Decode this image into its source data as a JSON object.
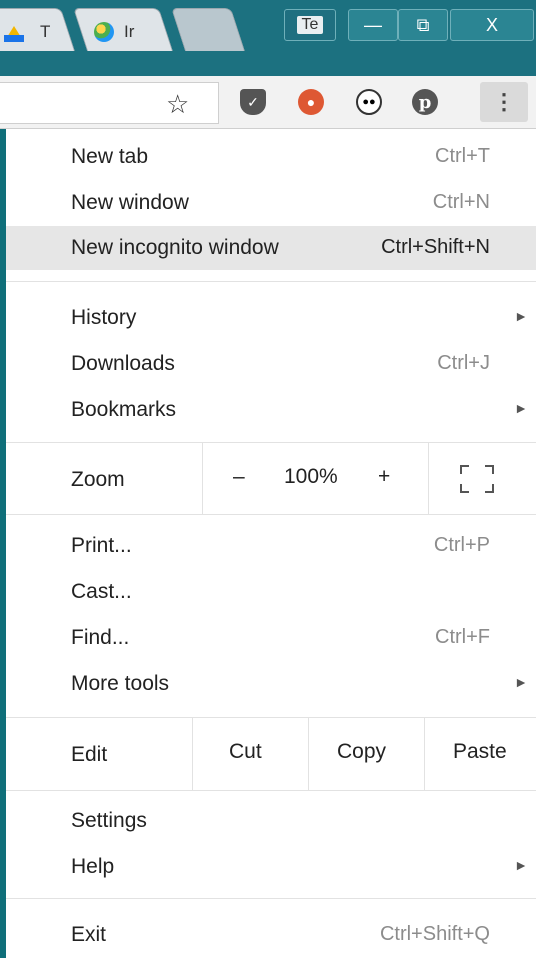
{
  "titlebar": {
    "tabs": [
      {
        "label": "T",
        "icon": "google-drive-icon"
      },
      {
        "label": "Ir",
        "icon": "browser-tab-icon"
      }
    ],
    "profile_label": "Te",
    "minimize_glyph": "—",
    "maximize_glyph": "⧉",
    "close_glyph": "X"
  },
  "toolbar": {
    "bookmark_star_glyph": "☆",
    "extensions": [
      "pocket-icon",
      "duckduckgo-icon",
      "panda-icon",
      "pinterest-icon"
    ],
    "pinterest_glyph": "p",
    "menu_glyph": "⋮"
  },
  "menu": {
    "new_tab": {
      "label": "New tab",
      "shortcut": "Ctrl+T"
    },
    "new_window": {
      "label": "New window",
      "shortcut": "Ctrl+N"
    },
    "new_incognito": {
      "label": "New incognito window",
      "shortcut": "Ctrl+Shift+N"
    },
    "history": {
      "label": "History"
    },
    "downloads": {
      "label": "Downloads",
      "shortcut": "Ctrl+J"
    },
    "bookmarks": {
      "label": "Bookmarks"
    },
    "zoom": {
      "label": "Zoom",
      "minus": "–",
      "value": "100%",
      "plus": "+"
    },
    "print": {
      "label": "Print...",
      "shortcut": "Ctrl+P"
    },
    "cast": {
      "label": "Cast..."
    },
    "find": {
      "label": "Find...",
      "shortcut": "Ctrl+F"
    },
    "more_tools": {
      "label": "More tools"
    },
    "edit": {
      "label": "Edit",
      "cut": "Cut",
      "copy": "Copy",
      "paste": "Paste"
    },
    "settings": {
      "label": "Settings"
    },
    "help": {
      "label": "Help"
    },
    "exit": {
      "label": "Exit",
      "shortcut": "Ctrl+Shift+Q"
    },
    "submenu_arrow": "►"
  },
  "colors": {
    "frame": "#1c7180",
    "menu_background": "#ffffff",
    "highlight": "#e6e6e6",
    "shortcut_text": "#8c8c8c"
  }
}
